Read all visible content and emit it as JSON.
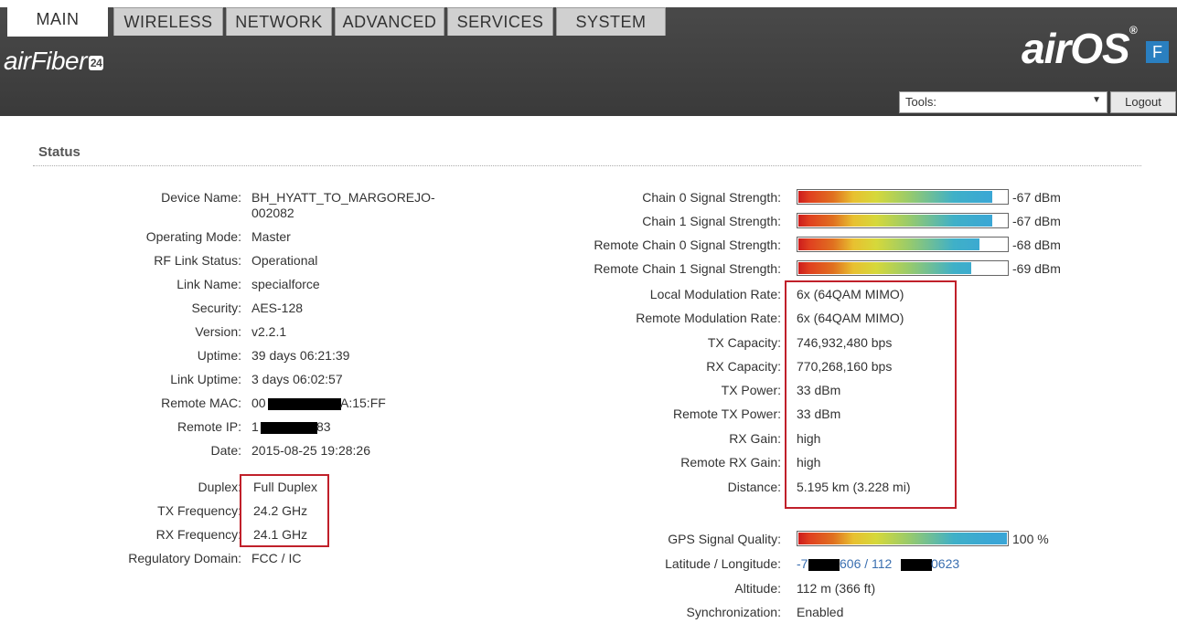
{
  "header": {
    "left_logo": "airFiber",
    "left_badge": "24",
    "right_logo": "airOS",
    "right_mark": "®",
    "right_badge": "F",
    "tabs": [
      "MAIN",
      "WIRELESS",
      "NETWORK",
      "ADVANCED",
      "SERVICES",
      "SYSTEM"
    ],
    "active_tab": "MAIN",
    "tools_label": "Tools:",
    "tools_arrow": "▼",
    "logout_label": "Logout"
  },
  "status": {
    "title": "Status",
    "left": [
      {
        "label": "Device Name:",
        "value": "BH_HYATT_TO_MARGOREJO-",
        "value2": "002082"
      },
      {
        "label": "Operating Mode:",
        "value": "Master"
      },
      {
        "label": "RF Link Status:",
        "value": "Operational"
      },
      {
        "label": "Link Name:",
        "value": "specialforce"
      },
      {
        "label": "Security:",
        "value": "AES-128"
      },
      {
        "label": "Version:",
        "value": "v2.2.1"
      },
      {
        "label": "Uptime:",
        "value": "39 days 06:21:39"
      },
      {
        "label": "Link Uptime:",
        "value": "3 days 06:02:57"
      },
      {
        "label": "Remote MAC:",
        "value_a": "00",
        "value_b": "A:15:FF"
      },
      {
        "label": "Remote IP:",
        "value_a": "1",
        "value_b": "83"
      },
      {
        "label": "Date:",
        "value": "2015-08-25 19:28:26"
      },
      {
        "label": "Duplex:",
        "value": "Full Duplex"
      },
      {
        "label": "TX Frequency:",
        "value": "24.2 GHz"
      },
      {
        "label": "RX Frequency:",
        "value": "24.1 GHz"
      },
      {
        "label": "Regulatory Domain:",
        "value": "FCC / IC"
      }
    ],
    "signals": [
      {
        "label": "Chain 0 Signal Strength:",
        "value": "-67 dBm",
        "level": 0.93
      },
      {
        "label": "Chain 1 Signal Strength:",
        "value": "-67 dBm",
        "level": 0.93
      },
      {
        "label": "Remote Chain 0 Signal Strength:",
        "value": "-68 dBm",
        "level": 0.87
      },
      {
        "label": "Remote Chain 1 Signal Strength:",
        "value": "-69 dBm",
        "level": 0.83
      }
    ],
    "right": [
      {
        "label": "Local Modulation Rate:",
        "value": "6x (64QAM MIMO)"
      },
      {
        "label": "Remote Modulation Rate:",
        "value": "6x (64QAM MIMO)"
      },
      {
        "label": "TX Capacity:",
        "value": "746,932,480 bps"
      },
      {
        "label": "RX Capacity:",
        "value": "770,268,160 bps"
      },
      {
        "label": "TX Power:",
        "value": "33 dBm"
      },
      {
        "label": "Remote TX Power:",
        "value": "33 dBm"
      },
      {
        "label": "RX Gain:",
        "value": "high"
      },
      {
        "label": "Remote RX Gain:",
        "value": "high"
      },
      {
        "label": "Distance:",
        "value": "5.195 km (3.228 mi)"
      }
    ],
    "gps": {
      "label": "GPS Signal Quality:",
      "value": "100 %",
      "level": 1.0
    },
    "latlon": {
      "label": "Latitude / Longitude:",
      "part1": "-7",
      "part2": "606 / 112",
      "part3": "0623"
    },
    "altitude": {
      "label": "Altitude:",
      "value": "112 m (366 ft)"
    },
    "sync": {
      "label": "Synchronization:",
      "value": "Enabled"
    }
  },
  "colors": {
    "header_bg": "#3d3d3d",
    "highlight_box": "#c0202a",
    "link": "#3a6fb0"
  }
}
